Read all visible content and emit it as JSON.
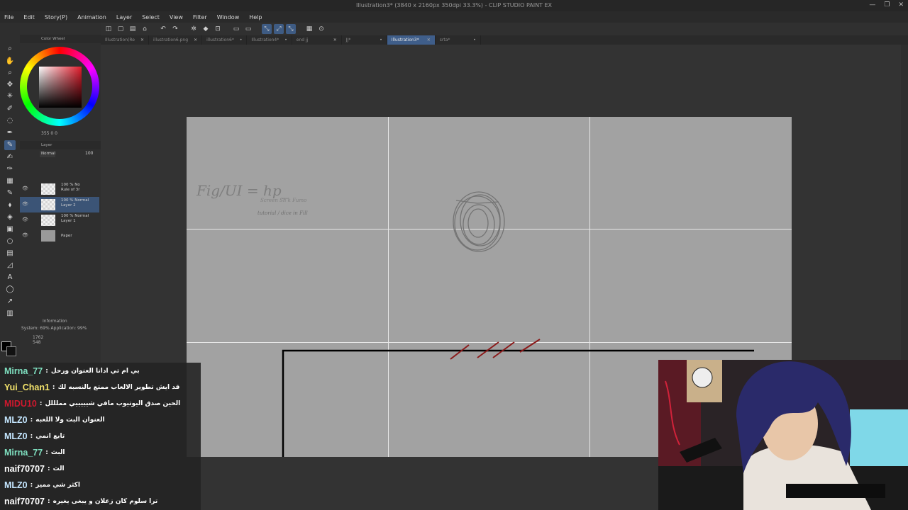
{
  "window": {
    "title": "Illustration3* (3840 x 2160px 350dpi 33.3%) - CLIP STUDIO PAINT EX",
    "controls": [
      "—",
      "❐",
      "✕"
    ]
  },
  "menu": [
    "File",
    "Edit",
    "Story(P)",
    "Animation",
    "Layer",
    "Select",
    "View",
    "Filter",
    "Window",
    "Help"
  ],
  "tabs": [
    {
      "label": "Illustration(Re",
      "active": false
    },
    {
      "label": "illustration6.png",
      "active": false
    },
    {
      "label": "illustration6*",
      "active": false
    },
    {
      "label": "Illustration4*",
      "active": false
    },
    {
      "label": "end jj",
      "active": false
    },
    {
      "label": "JJ*",
      "active": false
    },
    {
      "label": "Illustration3*",
      "active": true
    },
    {
      "label": "srta*",
      "active": false
    }
  ],
  "color_panel": {
    "title": "Color Wheel",
    "readout": "355  0  0",
    "current_color": "#000000",
    "hue_color": "#e21b2b"
  },
  "layer_panel": {
    "title": "Layer",
    "blend_mode": "Normal",
    "opacity": "100",
    "layers": [
      {
        "line1": "100 % No",
        "line2": "Rule of 3r",
        "active": false,
        "paper": false
      },
      {
        "line1": "100 % Normal",
        "line2": "Layer 2",
        "active": true,
        "paper": false
      },
      {
        "line1": "100 % Normal",
        "line2": "Layer 1",
        "active": false,
        "paper": false
      },
      {
        "line1": "",
        "line2": "Paper",
        "active": false,
        "paper": true
      }
    ]
  },
  "info_panel": {
    "title": "Information",
    "system": "System: 69%  Application: 99%",
    "x": "1762",
    "y": "548",
    "work_time": "Work time:"
  },
  "chat": [
    {
      "user": "Mirna_77",
      "color": "#7fe0c0",
      "message": "بي ام تي ادانا العنوان ورحل"
    },
    {
      "user": "Yui_Chan1",
      "color": "#f3e36b",
      "message": "قد ايش تطوير الالعاب ممتع بالنسبه لك"
    },
    {
      "user": "MIDU10",
      "color": "#d0182e",
      "message": "الحين صدق اليوتيوب مافي شيييييي مملللل"
    },
    {
      "user": "MLZ0",
      "color": "#c4e6ff",
      "message": "العنوان البث ولا اللعبه"
    },
    {
      "user": "MLZ0",
      "color": "#c4e6ff",
      "message": "تابع انمي"
    },
    {
      "user": "Mirna_77",
      "color": "#7fe0c0",
      "message": "البث"
    },
    {
      "user": "naif70707",
      "color": "#ffffff",
      "message": "الث"
    },
    {
      "user": "MLZ0",
      "color": "#c4e6ff",
      "message": "اكثر شي مميز"
    },
    {
      "user": "naif70707",
      "color": "#ffffff",
      "message": "ترا سلوم كان زعلان و يبغى يغيره"
    }
  ],
  "canvas": {
    "note_line1": "Fig/UI = hp_",
    "note_line2": "Screen  Sh k  Fumo",
    "note_line3": "tutorial / dice in Fill"
  }
}
